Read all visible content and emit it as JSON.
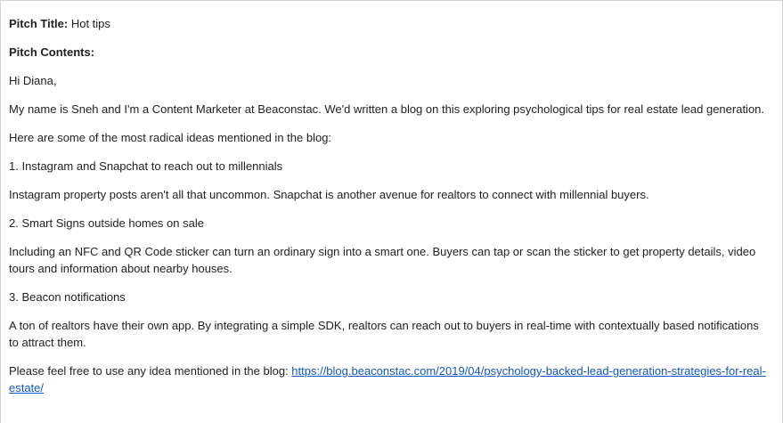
{
  "pitch": {
    "title_label": "Pitch Title:",
    "title_value": " Hot tips",
    "contents_label": "Pitch Contents:"
  },
  "email": {
    "greeting": "Hi Diana,",
    "intro": "My name is Sneh and I'm a Content Marketer at Beaconstac. We'd written a blog on this exploring psychological tips for real estate lead generation.",
    "lead_in": "Here are some of the most radical ideas mentioned in the blog:",
    "ideas": [
      {
        "heading": "1. Instagram and Snapchat to reach out to millennials",
        "body": "Instagram property posts aren't all that uncommon. Snapchat is another avenue for realtors to connect with millennial buyers."
      },
      {
        "heading": "2. Smart Signs outside homes on sale",
        "body": "Including an NFC and QR Code sticker can turn an ordinary sign into a smart one. Buyers can tap or scan the sticker to get property details, video tours and information about nearby houses."
      },
      {
        "heading": "3. Beacon notifications",
        "body": "A ton of realtors have their own app. By integrating a simple SDK, realtors can reach out to buyers in real-time with contextually based notifications to attract them."
      }
    ],
    "closing_text": "Please feel free to use any idea mentioned in the blog: ",
    "blog_link": "https://blog.beaconstac.com/2019/04/psychology-backed-lead-generation-strategies-for-real-estate/"
  },
  "colors": {
    "text": "#222222",
    "link": "#1155cc",
    "border": "#d4d4d4",
    "background": "#ffffff"
  }
}
